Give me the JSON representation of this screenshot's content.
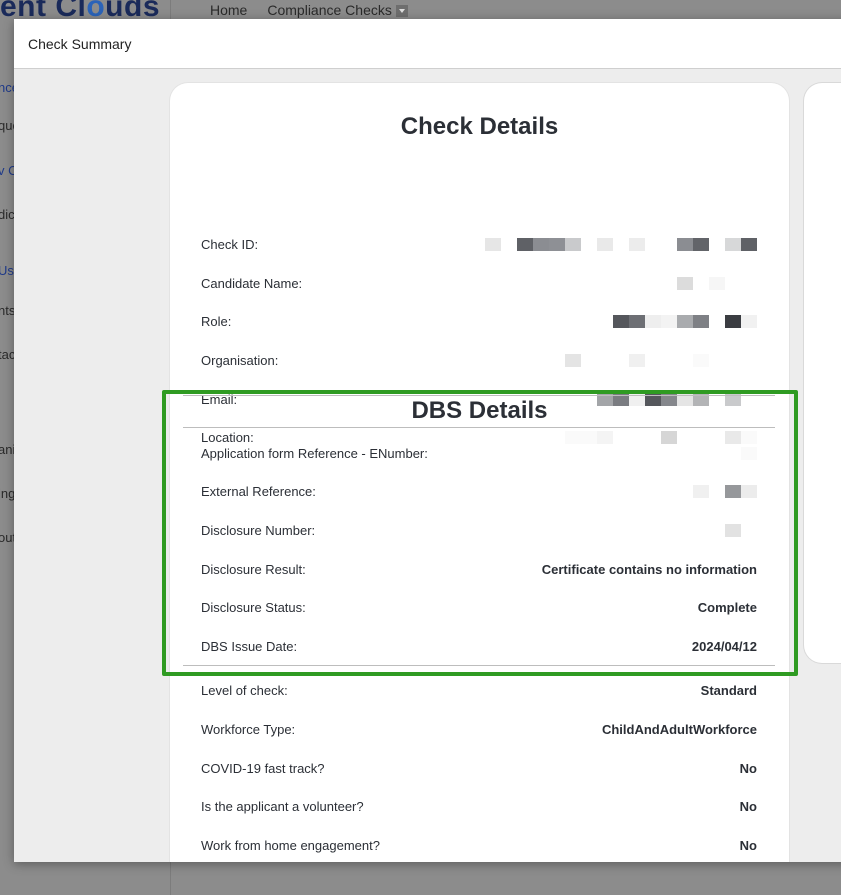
{
  "background": {
    "logo": {
      "part1": "ent Cl",
      "o": "o",
      "part2": "uds"
    },
    "nav": {
      "home": "Home",
      "compliance": "Compliance Checks"
    },
    "side_fragments": [
      "nce",
      "que",
      "v C",
      "dic",
      "Us",
      "nts",
      "tac",
      "ani",
      "ing",
      "out"
    ]
  },
  "modal": {
    "title": "Check Summary"
  },
  "check_details": {
    "title": "Check Details",
    "rows": [
      {
        "label": "Check ID:"
      },
      {
        "label": "Candidate Name:"
      },
      {
        "label": "Role:"
      },
      {
        "label": "Organisation:"
      },
      {
        "label": "Email:"
      },
      {
        "label": "Location:"
      }
    ]
  },
  "dbs_details": {
    "title": "DBS Details",
    "rows": [
      {
        "label": "Application form Reference - ENumber:",
        "value": ""
      },
      {
        "label": "External Reference:",
        "value": ""
      },
      {
        "label": "Disclosure Number:",
        "value": ""
      },
      {
        "label": "Disclosure Result:",
        "value": "Certificate contains no information"
      },
      {
        "label": "Disclosure Status:",
        "value": "Complete"
      },
      {
        "label": "DBS Issue Date:",
        "value": "2024/04/12"
      }
    ]
  },
  "extra_details": {
    "rows": [
      {
        "label": "Level of check:",
        "value": "Standard"
      },
      {
        "label": "Workforce Type:",
        "value": "ChildAndAdultWorkforce"
      },
      {
        "label": "COVID-19 fast track?",
        "value": "No"
      },
      {
        "label": "Is the applicant a volunteer?",
        "value": "No"
      },
      {
        "label": "Work from home engagement?",
        "value": "No"
      }
    ]
  },
  "colors": {
    "highlight": "#2f9b22",
    "text": "#2b2f36",
    "logo": "#1a2a5a",
    "logo_accent": "#2b63b8"
  }
}
